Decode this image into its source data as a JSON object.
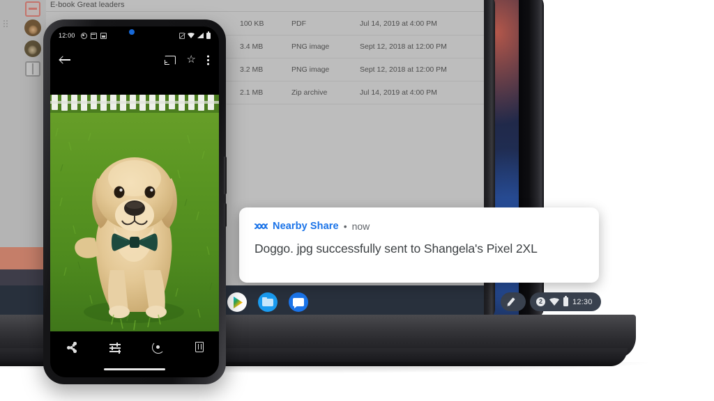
{
  "scene": {
    "description": "Chromebook with Nearby Share notification beside an Android phone showing a dog photo"
  },
  "files_window": {
    "title": "E-book Great leaders",
    "sidebar": {
      "items": [
        {
          "name": "pdf-badge-icon",
          "label": ""
        },
        {
          "name": "avatar-1",
          "label": ""
        },
        {
          "name": "avatar-2",
          "label": ""
        },
        {
          "name": "split-panel-icon",
          "label": ""
        }
      ]
    },
    "rows": [
      {
        "size": "100 KB",
        "type": "PDF",
        "date": "Jul 14, 2019 at 4:00 PM"
      },
      {
        "size": "3.4 MB",
        "type": "PNG image",
        "date": "Sept 12, 2018 at 12:00 PM"
      },
      {
        "size": "3.2 MB",
        "type": "PNG image",
        "date": "Sept 12, 2018 at 12:00 PM"
      },
      {
        "size": "2.1 MB",
        "type": "Zip archive",
        "date": "Jul 14, 2019 at 4:00 PM"
      }
    ]
  },
  "shelf": {
    "apps": [
      {
        "name": "play-store",
        "label": "Play Store"
      },
      {
        "name": "files",
        "label": "Files"
      },
      {
        "name": "messages",
        "label": "Messages"
      }
    ],
    "status": {
      "pen_label": "Stylus",
      "badge_count": "2",
      "wifi_label": "Wi-Fi",
      "battery_label": "Battery",
      "time": "12:30"
    }
  },
  "notification": {
    "app_name": "Nearby Share",
    "separator": "•",
    "time": "now",
    "body": "Doggo. jpg successfully sent to Shangela's Pixel 2XL",
    "accent_color": "#1a73e8",
    "body_color": "#3c4043"
  },
  "phone": {
    "status_bar": {
      "time": "12:00",
      "left_icons": [
        "whatsapp-icon",
        "mail-icon",
        "photo-icon"
      ],
      "right_icons": [
        "vibrate-icon",
        "wifi-icon",
        "signal-icon",
        "battery-icon"
      ]
    },
    "toolbar": {
      "back_label": "Back",
      "cast_label": "Cast",
      "star_glyph": "☆",
      "more_label": "More options"
    },
    "photo": {
      "subject": "Golden retriever puppy with green bow tie on grass"
    },
    "bottom_bar": {
      "actions": [
        {
          "name": "share-icon",
          "label": "Share"
        },
        {
          "name": "tune-icon",
          "label": "Edit"
        },
        {
          "name": "lens-icon",
          "label": "Lens"
        },
        {
          "name": "delete-icon",
          "label": "Delete"
        }
      ]
    }
  }
}
